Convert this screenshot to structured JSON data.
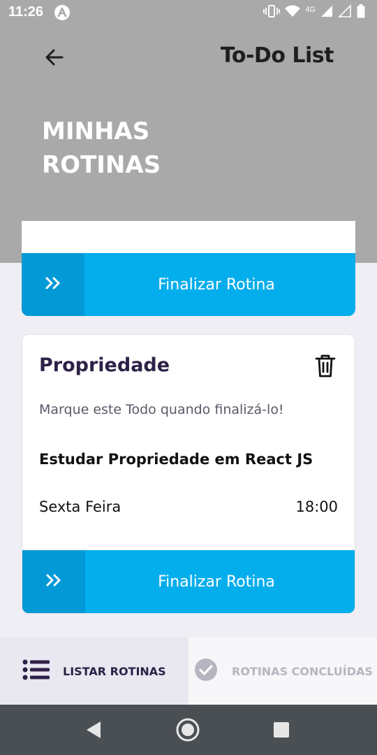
{
  "status_bar": {
    "time": "11:26",
    "network_label": "4G",
    "icons": [
      "app-notification-icon",
      "vibrate-icon",
      "wifi-icon",
      "signal-icon",
      "signal-icon",
      "battery-icon"
    ]
  },
  "header": {
    "app_title": "To-Do List",
    "page_title": "MINHAS ROTINAS",
    "back_icon": "arrow-left-icon"
  },
  "cards": [
    {
      "finish_button_label": "Finalizar Rotina"
    },
    {
      "title": "Propriedade",
      "hint": "Marque este Todo quando finalizá-lo!",
      "description": "Estudar Propriedade em React JS",
      "day": "Sexta Feira",
      "time": "18:00",
      "finish_button_label": "Finalizar Rotina"
    }
  ],
  "tabs": [
    {
      "label": "LISTAR ROTINAS",
      "icon": "list-icon",
      "active": true
    },
    {
      "label": "ROTINAS CONCLUÍDAS",
      "icon": "check-circle-icon",
      "active": false
    }
  ],
  "colors": {
    "header_bg": "#A9A9A9",
    "accent": "#04ADEB",
    "accent_dark": "#0399D6",
    "title_text": "#2D2147",
    "page_bg": "#EFEEF4"
  }
}
